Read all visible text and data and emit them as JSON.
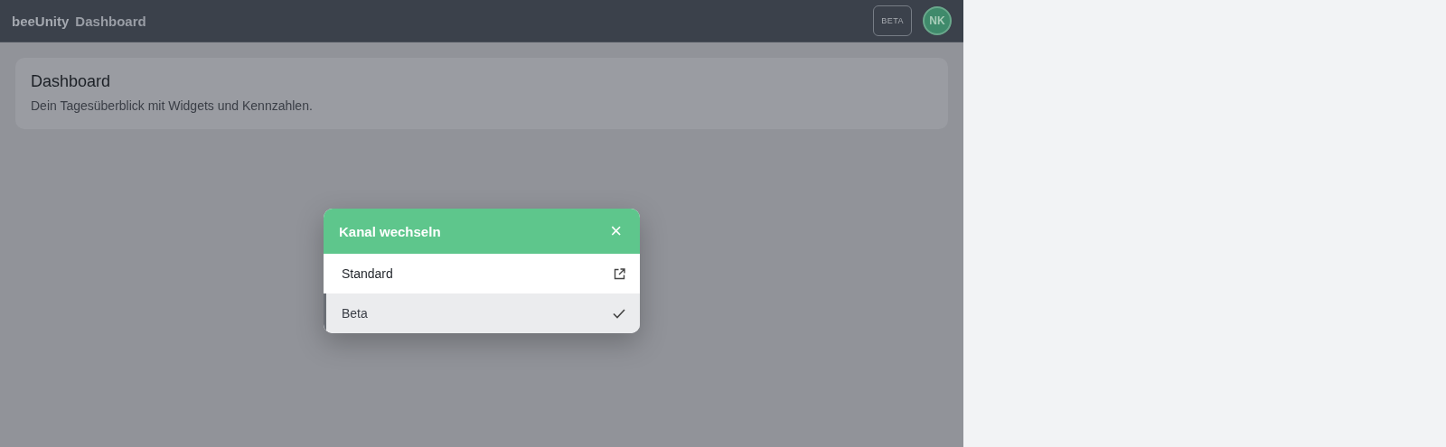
{
  "header": {
    "brand": "beeUnity",
    "title": "Dashboard",
    "channel_badge": "BETA",
    "avatar": "NK"
  },
  "page": {
    "title": "Dashboard",
    "subtitle": "Dein Tagesüberblick mit Widgets und Kennzahlen."
  },
  "dialog": {
    "title": "Kanal wechseln",
    "close": "×",
    "channels": [
      {
        "label": "Standard",
        "selected": false
      },
      {
        "label": "Beta",
        "selected": true
      }
    ]
  }
}
